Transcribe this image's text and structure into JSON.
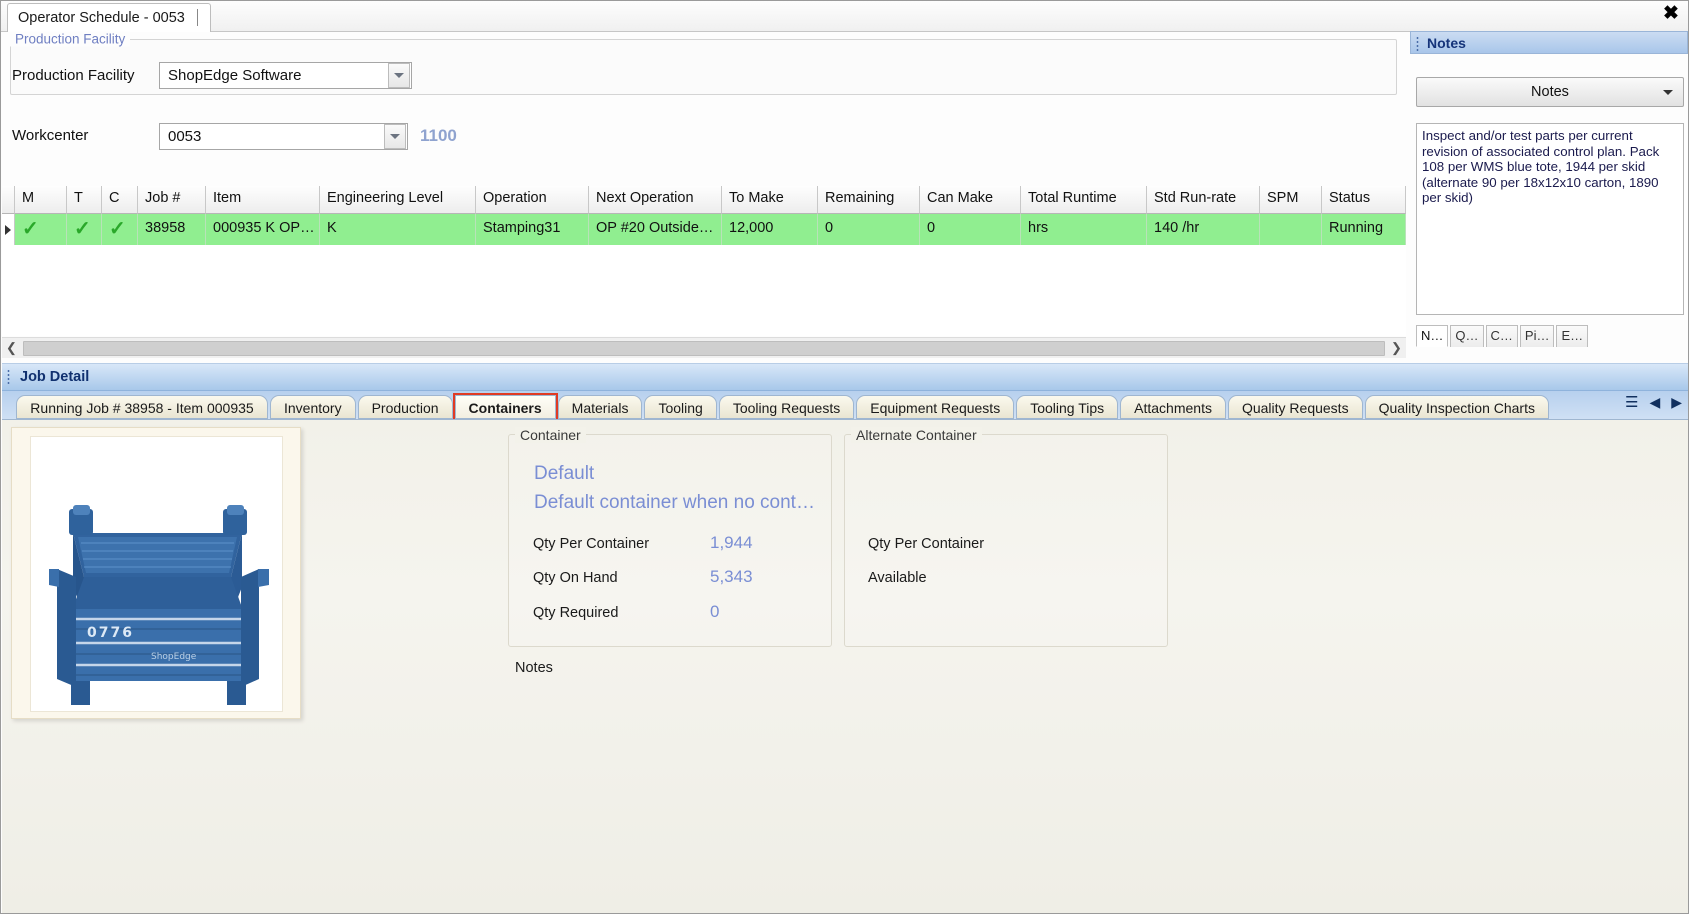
{
  "window": {
    "tab_title": "Operator Schedule - 0053",
    "close_icon": "close-icon"
  },
  "facility_group": {
    "legend": "Production Facility",
    "label": "Production Facility",
    "value": "ShopEdge Software"
  },
  "workcenter": {
    "label": "Workcenter",
    "value": "0053",
    "number": "1100"
  },
  "schedule_grid": {
    "columns": [
      "M",
      "T",
      "C",
      "Job #",
      "Item",
      "Engineering Level",
      "Operation",
      "Next Operation",
      "To Make",
      "Remaining",
      "Can Make",
      "Total Runtime",
      "Std Run-rate",
      "SPM",
      "Status"
    ],
    "rows": [
      {
        "m": "✓",
        "t": "✓",
        "c": "✓",
        "job": "38958",
        "item": "000935  K  OP…",
        "engineering_level": "K",
        "operation": "Stamping31",
        "next_operation": "OP  #20  Outside…",
        "to_make": "12,000",
        "remaining": "0",
        "can_make": "0",
        "total_runtime": "hrs",
        "std_run_rate": "140 /hr",
        "spm": "",
        "status": "Running"
      }
    ]
  },
  "notes_panel": {
    "title": "Notes",
    "button_label": "Notes",
    "text": "Inspect and/or test parts per current revision of associated control plan. Pack 108 per WMS blue tote, 1944 per skid (alternate 90 per 18x12x10 carton, 1890 per skid)",
    "tabs": [
      "N…",
      "Q…",
      "C…",
      "Pi…",
      "E…"
    ],
    "active_tab": "N…"
  },
  "job_detail": {
    "header": "Job Detail",
    "tabs": [
      "Running Job # 38958 - Item 000935",
      "Inventory",
      "Production",
      "Containers",
      "Materials",
      "Tooling",
      "Tooling Requests",
      "Equipment Requests",
      "Tooling Tips",
      "Attachments",
      "Quality Requests",
      "Quality Inspection Charts"
    ],
    "selected_tab": "Containers",
    "nav": {
      "menu_icon": "tab-list-icon",
      "prev_icon": "chevron-left-icon",
      "next_icon": "chevron-right-icon"
    }
  },
  "containers_tab": {
    "image": {
      "name": "container-photo",
      "marking": "0776"
    },
    "container": {
      "legend": "Container",
      "name": "Default",
      "description": "Default container when no cont…",
      "fields": [
        {
          "label": "Qty Per Container",
          "value": "1,944"
        },
        {
          "label": "Qty On Hand",
          "value": "5,343"
        },
        {
          "label": "Qty Required",
          "value": "0"
        }
      ]
    },
    "alternate_container": {
      "legend": "Alternate Container",
      "name": "",
      "description": "",
      "fields": [
        {
          "label": "Qty Per Container",
          "value": ""
        },
        {
          "label": "Available",
          "value": ""
        }
      ]
    },
    "notes_label": "Notes"
  },
  "colors": {
    "running_row": "#90ee90",
    "accent_blue": "#7a8ed4",
    "selected_tab_outline": "#e03a24",
    "panel_header": "#a9c6ea"
  }
}
